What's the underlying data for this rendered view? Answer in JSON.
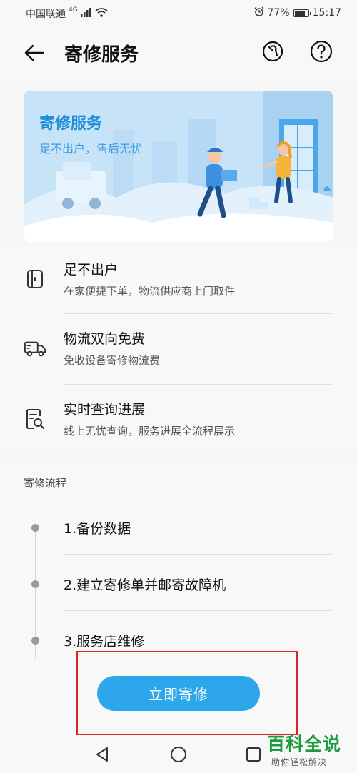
{
  "status_bar": {
    "carrier": "中国联通",
    "network": "4G",
    "battery": "77%",
    "time": "15:17"
  },
  "header": {
    "title": "寄修服务",
    "icons": [
      "back-arrow-icon",
      "wrench-icon",
      "question-icon"
    ]
  },
  "banner": {
    "title": "寄修服务",
    "subtitle": "足不出户，售后无忧"
  },
  "features": [
    {
      "icon": "phone-icon",
      "title": "足不出户",
      "desc": "在家便捷下单，物流供应商上门取件"
    },
    {
      "icon": "truck-icon",
      "title": "物流双向免费",
      "desc": "免收设备寄修物流费"
    },
    {
      "icon": "search-document-icon",
      "title": "实时查询进展",
      "desc": "线上无忧查询，服务进展全流程展示"
    }
  ],
  "process": {
    "label": "寄修流程",
    "steps": [
      "1.备份数据",
      "2.建立寄修单并邮寄故障机",
      "3.服务店维修"
    ]
  },
  "action": {
    "button_label": "立即寄修"
  },
  "nav_bar": {
    "icons": [
      "back-triangle-icon",
      "home-circle-icon",
      "recents-square-icon"
    ]
  },
  "watermark": {
    "title": "百科全说",
    "subtitle": "助你轻松解决"
  },
  "colors": {
    "accent": "#2ea6ec",
    "banner_bg": "#c7e3f8",
    "highlight": "#d9262c",
    "watermark": "#1a9b3e"
  }
}
